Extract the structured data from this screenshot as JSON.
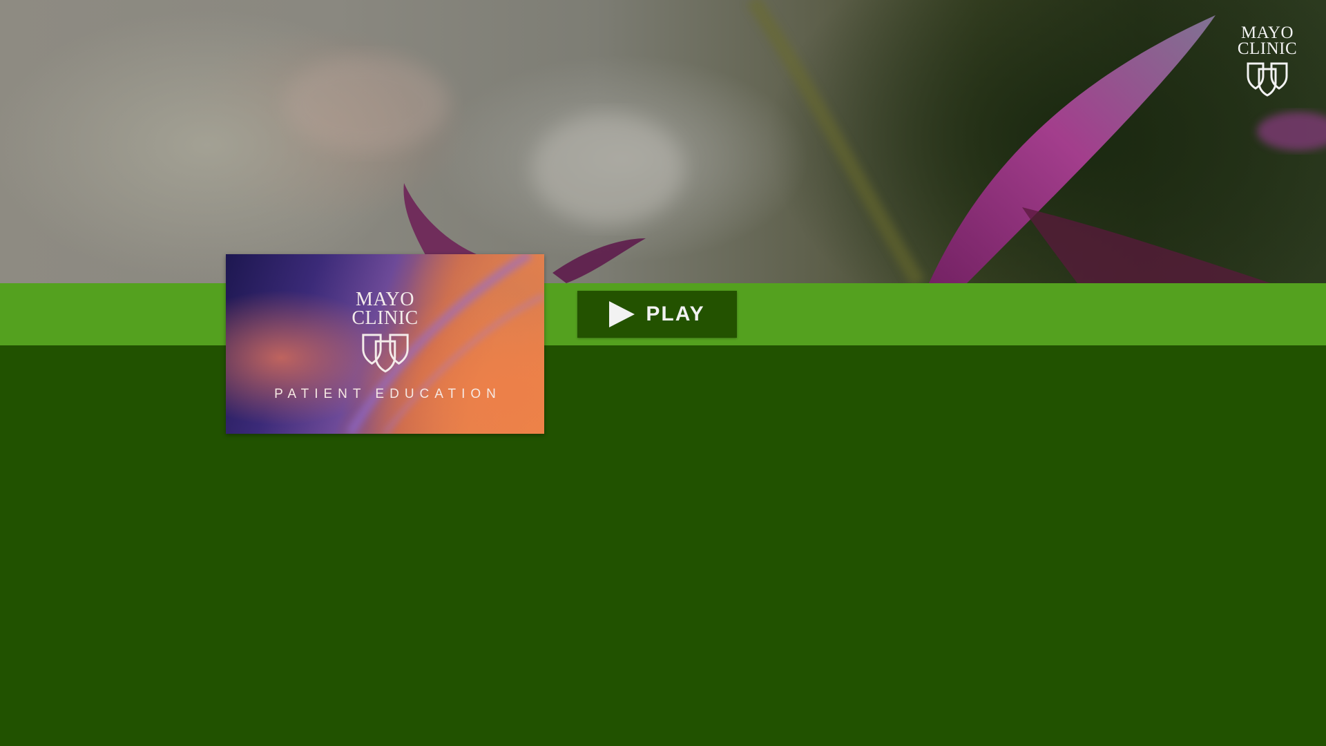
{
  "brand": {
    "logo_line1": "MAYO",
    "logo_line2": "CLINIC",
    "logo_icon": "shield-icon"
  },
  "video": {
    "thumbnail": {
      "logo_line1": "MAYO",
      "logo_line2": "CLINIC",
      "caption": "PATIENT EDUCATION"
    },
    "play_label": "PLAY",
    "play_icon": "play-icon"
  },
  "colors": {
    "band": "#54a11f",
    "page_background": "#215200",
    "play_button": "#235200"
  }
}
